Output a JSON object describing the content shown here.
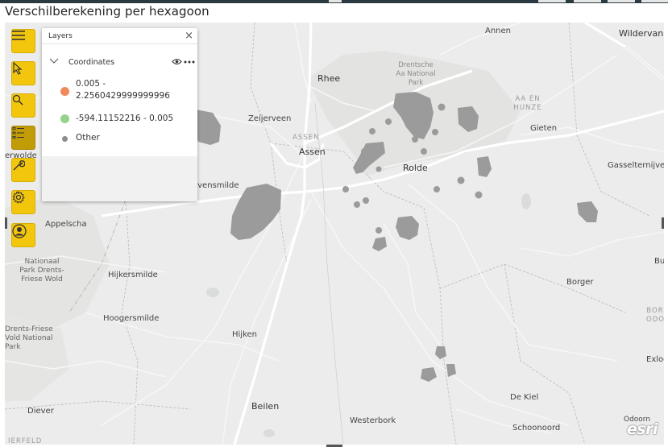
{
  "visual_title": "Verschilberekening per hexagoon",
  "toolbar": {
    "buttons": [
      {
        "name": "menu-button",
        "icon": "hamburger-icon"
      },
      {
        "name": "select-button",
        "icon": "cursor-arrow-icon"
      },
      {
        "name": "search-button",
        "icon": "magnifier-icon"
      },
      {
        "name": "layers-button",
        "icon": "layer-list-icon",
        "active": true
      },
      {
        "name": "tools-button",
        "icon": "wrench-icon"
      },
      {
        "name": "settings-button",
        "icon": "gear-icon"
      },
      {
        "name": "account-button",
        "icon": "person-icon"
      }
    ]
  },
  "layers_panel": {
    "title": "Layers",
    "close_label": "×",
    "layer_name": "Coordinates",
    "legend": [
      {
        "label_line1": "0.005 -",
        "label_line2": "2.2560429999999996",
        "color": "#f08a5d"
      },
      {
        "label_line1": "-594.11152216 - 0.005",
        "label_line2": "",
        "color": "#95d38c"
      },
      {
        "label_line1": "Other",
        "label_line2": "",
        "color": "#8c8c8c"
      }
    ]
  },
  "map": {
    "places": {
      "annen": "Annen",
      "wildervank": "Wildervank",
      "rhee": "Rhee",
      "drentsche_1": "Drentsche",
      "drentsche_2": "Aa National",
      "drentsche_3": "Park",
      "aa_en_hunze_1": "AA EN",
      "aa_en_hunze_2": "HUNZE",
      "zeijerveen": "Zeijerveen",
      "assen_caps": "ASSEN",
      "assen": "Assen",
      "gieten": "Gieten",
      "erwolde": "erwolde",
      "rolde": "Rolde",
      "gasselternijveen": "Gasselternijvee",
      "ovensmilde": "ovensmilde",
      "appelscha": "Appelscha",
      "bu": "Bu",
      "nat_park_1": "Nationaal",
      "nat_park_2": "Park Drents-",
      "nat_park_3": "Friese Wold",
      "hijkersmilde": "Hijkersmilde",
      "borger": "Borger",
      "bor_1": "BOR",
      "bor_2": "ODO",
      "hoogersmilde": "Hoogersmilde",
      "drents_friese_1": "Drents-Friese",
      "drents_friese_2": "Vold National",
      "drents_friese_3": "Park",
      "hijken": "Hijken",
      "exloo": "Exloo",
      "de_kiel": "De Kiel",
      "beilen": "Beilen",
      "diever": "Diever",
      "westerbork": "Westerbork",
      "schoonoord": "Schoonoord",
      "odoorn": "Odoorn",
      "ierfeld": "IERFELD"
    },
    "attribution": "esri",
    "cluster_color": "#9b9b9b"
  }
}
